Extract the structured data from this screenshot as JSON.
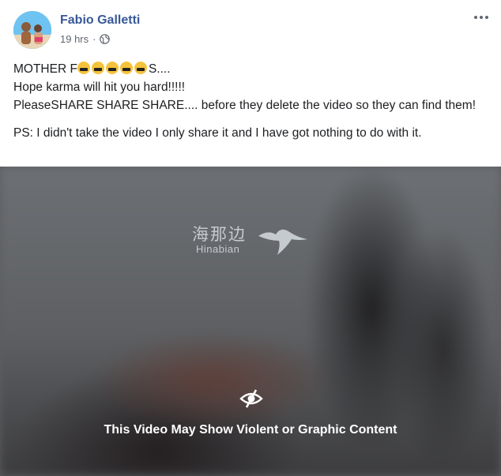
{
  "post": {
    "author": "Fabio Galletti",
    "time": "19 hrs",
    "separator": "·",
    "lines": {
      "line1_start": "MOTHER F",
      "line1_end": "S....",
      "line2": "Hope karma will hit you hard!!!!!",
      "line3": "PleaseSHARE SHARE SHARE.... before they delete the video so they can find them!",
      "line4": "PS: I didn't take the video I only share it and I have got nothing to do with it."
    },
    "emoji_count": 5
  },
  "video": {
    "watermark_cn": "海那边",
    "watermark_en": "Hinabian",
    "warning": "This Video May Show Violent or Graphic Content"
  },
  "icons": {
    "globe": "globe-icon",
    "more": "more-options-icon",
    "eye": "eye-slash-icon"
  },
  "colors": {
    "author": "#385898",
    "text": "#1c1e21",
    "meta": "#616770"
  }
}
